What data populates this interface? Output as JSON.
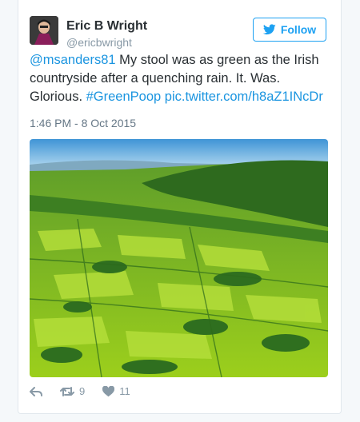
{
  "author": {
    "name": "Eric B Wright",
    "handle": "@ericbwright"
  },
  "follow_label": "Follow",
  "tweet": {
    "mention": "@msanders81",
    "text": " My stool was as green as the Irish countryside after a quenching rain. It. Was. Glorious. ",
    "hashtag": "#GreenPoop",
    "media_link": " pic.twitter.com/h8aZ1INcDr",
    "timestamp": "1:46 PM - 8 Oct 2015"
  },
  "stats": {
    "retweets": "9",
    "likes": "11"
  },
  "colors": {
    "link": "#1b95e0",
    "follow": "#1da1f2",
    "meta": "#8899a6"
  },
  "icons": [
    "reply-icon",
    "retweet-icon",
    "heart-icon",
    "twitter-bird-icon"
  ]
}
